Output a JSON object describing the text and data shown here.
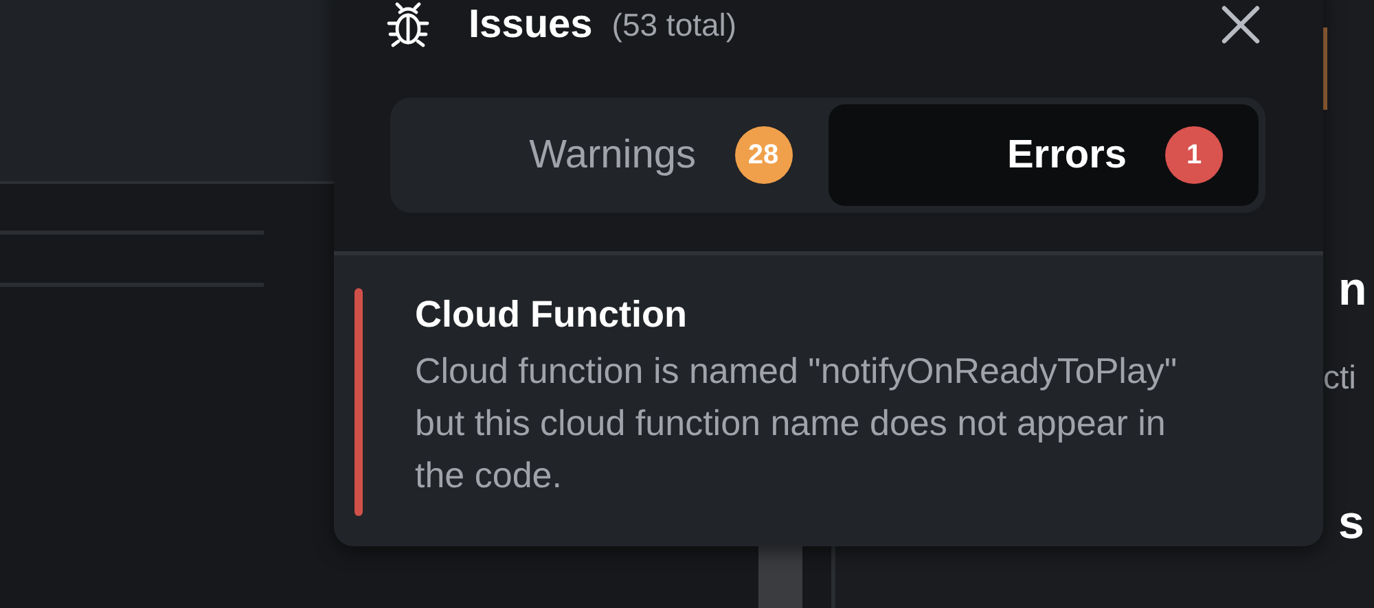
{
  "background_fragments": [
    "n",
    "cti",
    "s"
  ],
  "panel": {
    "title": "Issues",
    "count": "(53 total)"
  },
  "tabs": [
    {
      "label": "Warnings",
      "badge": "28",
      "color": "#f0a04b",
      "selected": false
    },
    {
      "label": "Errors",
      "badge": "1",
      "color": "#d9534f",
      "selected": true
    }
  ],
  "issues": [
    {
      "kind": "error",
      "title": "Cloud Function",
      "message": "Cloud function is named \"notifyOnReadyToPlay\" but this cloud function name does not appear in the code."
    }
  ]
}
